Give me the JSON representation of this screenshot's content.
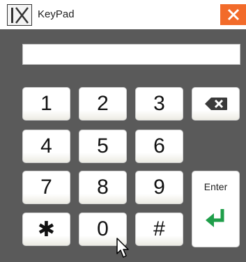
{
  "window": {
    "title": "KeyPad",
    "logo_text": "IX",
    "close_label": "✕"
  },
  "display": {
    "value": ""
  },
  "keys": {
    "k1": "1",
    "k2": "2",
    "k3": "3",
    "k4": "4",
    "k5": "5",
    "k6": "6",
    "k7": "7",
    "k8": "8",
    "k9": "9",
    "star": "✱",
    "k0": "0",
    "hash": "#",
    "enter": "Enter"
  },
  "icons": {
    "backspace": "backspace-icon",
    "enter_arrow": "enter-arrow-icon",
    "close": "close-icon"
  },
  "colors": {
    "window_bg": "#5a5a5a",
    "close_bg": "#f26b2a",
    "enter_arrow": "#1f9e4a"
  }
}
